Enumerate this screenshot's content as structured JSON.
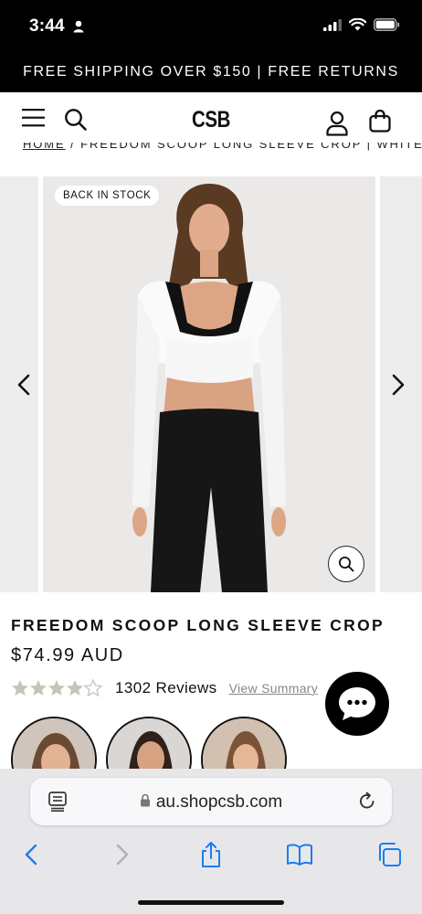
{
  "status_bar": {
    "time": "3:44"
  },
  "promo": {
    "text": "FREE SHIPPING OVER $150 | FREE RETURNS"
  },
  "header": {
    "logo": "CSB"
  },
  "breadcrumb": {
    "home": "HOME",
    "separator": "/",
    "current": "FREEDOM SCOOP LONG SLEEVE CROP | WHITE"
  },
  "gallery": {
    "badge": "BACK IN STOCK"
  },
  "product": {
    "title": "FREEDOM SCOOP LONG SLEEVE CROP",
    "price": "$74.99 AUD",
    "rating": 4.5,
    "review_count": "1302 Reviews",
    "view_summary": "View Summary"
  },
  "safari": {
    "url": "au.shopcsb.com"
  },
  "colors": {
    "accent_ios": "#1a7cf5",
    "star_fill": "#c9c2b8",
    "banner_bg": "#000000"
  },
  "icons": [
    "person-icon",
    "signal-icon",
    "wifi-icon",
    "battery-icon",
    "menu-icon",
    "search-icon",
    "account-icon",
    "bag-icon",
    "chevron-left-icon",
    "chevron-right-icon",
    "zoom-icon",
    "chat-icon",
    "reader-icon",
    "lock-icon",
    "reload-icon",
    "back-icon",
    "forward-icon",
    "share-icon",
    "bookmarks-icon",
    "tabs-icon"
  ]
}
